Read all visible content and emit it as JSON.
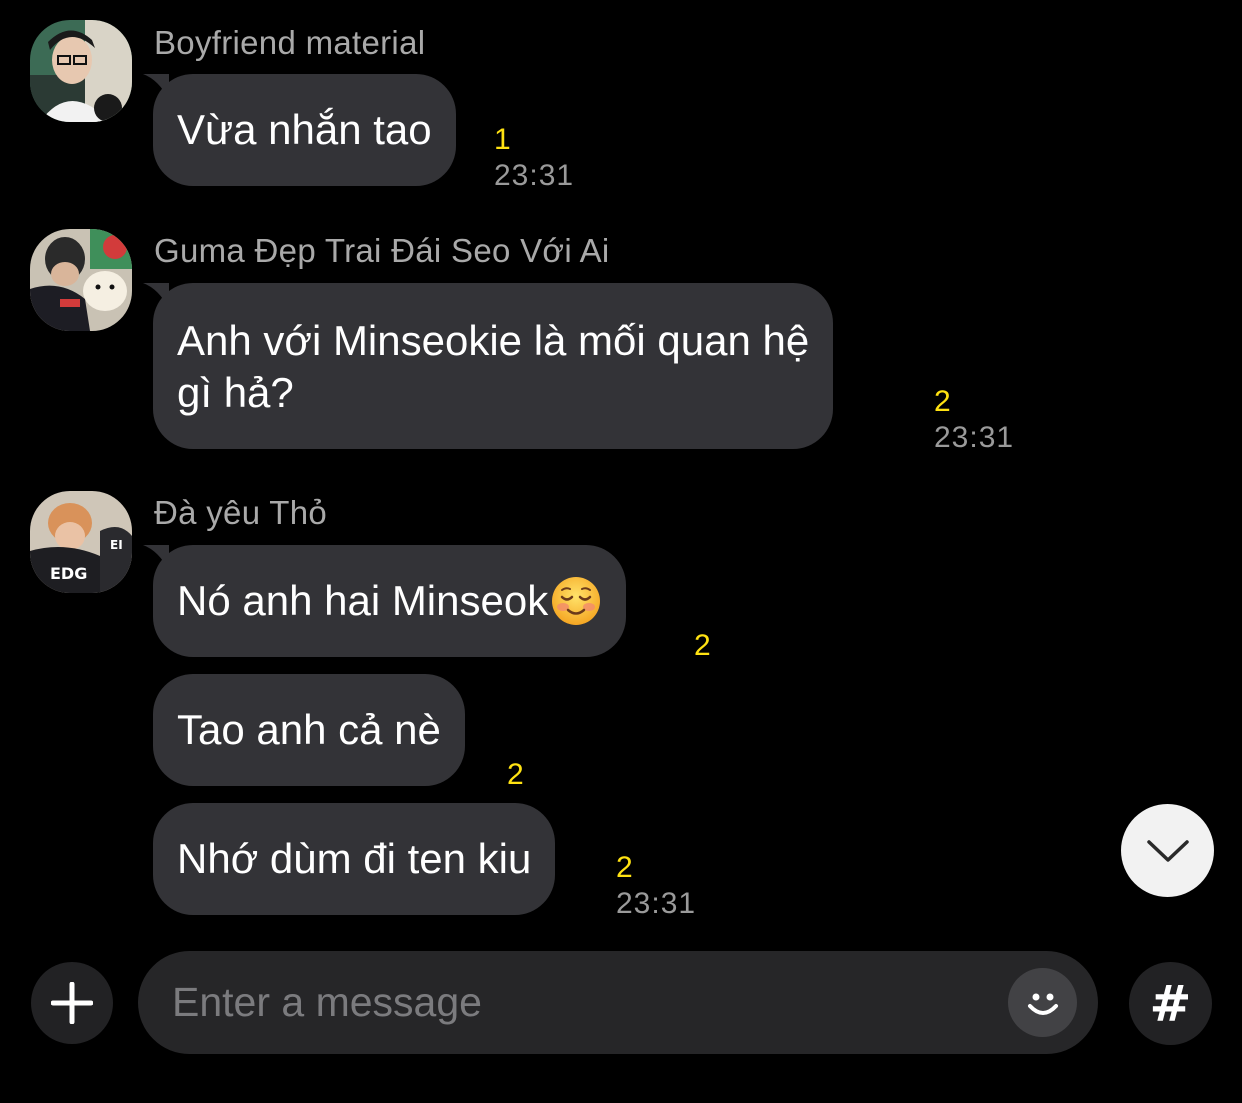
{
  "messages": [
    {
      "sender": "Boyfriend material",
      "bubbles": [
        {
          "lines": [
            "Vừa nhắn tao"
          ],
          "unread": "1",
          "time": "23:31"
        }
      ]
    },
    {
      "sender": "Guma Đẹp Trai Đái Seo Với Ai",
      "bubbles": [
        {
          "lines": [
            "Anh với Minseokie là mối quan hệ",
            "gì hả?"
          ],
          "unread": "2",
          "time": "23:31"
        }
      ]
    },
    {
      "sender": "Đà yêu Thỏ",
      "bubbles": [
        {
          "lines": [
            "Nó anh hai Minseok"
          ],
          "emoji": "relieved-smile",
          "unread": "2",
          "time": ""
        },
        {
          "lines": [
            "Tao anh cả nè"
          ],
          "unread": "2",
          "time": ""
        },
        {
          "lines": [
            "Nhớ dùm đi ten kiu"
          ],
          "unread": "2",
          "time": "23:31"
        }
      ]
    }
  ],
  "composer": {
    "placeholder": "Enter a message",
    "hashtag_label": "#"
  },
  "icons": {
    "add": "plus-icon",
    "emoticon": "smiley-icon",
    "hashtag": "hash-icon",
    "scroll_down": "chevron-down-icon"
  },
  "colors": {
    "background": "#000000",
    "bubble": "#333337",
    "unread": "#ffe212",
    "time": "#9a9a9a",
    "sender": "#a9a9a9"
  }
}
